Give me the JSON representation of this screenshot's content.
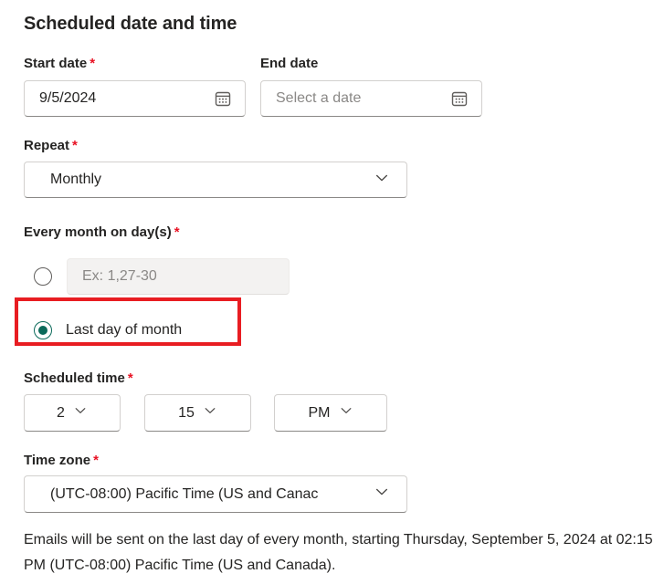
{
  "section": {
    "title": "Scheduled date and time"
  },
  "fields": {
    "start_date": {
      "label": "Start date",
      "required_marker": "*",
      "value": "9/5/2024",
      "icon": "calendar-icon"
    },
    "end_date": {
      "label": "End date",
      "required_marker": "",
      "value": "",
      "placeholder": "Select a date",
      "icon": "calendar-icon"
    },
    "repeat": {
      "label": "Repeat",
      "required_marker": "*",
      "value": "Monthly",
      "icon": "chevron-down-icon"
    },
    "every_month_on_days": {
      "label": "Every month on day(s)",
      "required_marker": "*",
      "options": [
        {
          "id": "specific-days",
          "selected": false,
          "input_placeholder": "Ex: 1,27-30",
          "input_value": "",
          "disabled": true
        },
        {
          "id": "last-day-of-month",
          "selected": true,
          "label": "Last day of month",
          "highlighted": true
        }
      ]
    },
    "scheduled_time": {
      "label": "Scheduled time",
      "required_marker": "*",
      "hour": "2",
      "minute": "15",
      "meridiem": "PM"
    },
    "time_zone": {
      "label": "Time zone",
      "required_marker": "*",
      "value": "(UTC-08:00) Pacific Time (US and Canac"
    }
  },
  "summary": {
    "text": "Emails will be sent on the last day of every month, starting Thursday, September 5, 2024 at 02:15 PM (UTC-08:00) Pacific Time (US and Canada)."
  },
  "colors": {
    "required_asterisk": "#e81123",
    "radio_selected": "#0b6a5a",
    "highlight_border": "#e81d22",
    "text_primary": "#252423",
    "text_placeholder": "#8a8886",
    "border": "#d2d0ce",
    "disabled_fill": "#f3f2f1"
  }
}
